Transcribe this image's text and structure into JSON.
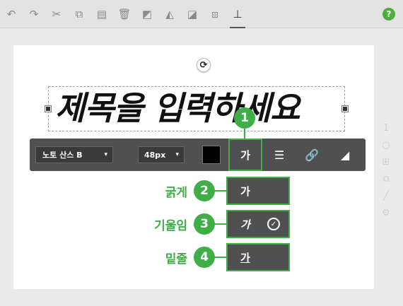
{
  "toolbar": {
    "buttons": [
      {
        "name": "undo-icon",
        "glyph": "↶"
      },
      {
        "name": "redo-icon",
        "glyph": "↷"
      },
      {
        "name": "cut-icon",
        "glyph": "✂"
      },
      {
        "name": "copy-icon",
        "glyph": "⧉"
      },
      {
        "name": "paste-icon",
        "glyph": "▤"
      },
      {
        "name": "delete-icon",
        "glyph": "🗑"
      },
      {
        "name": "layer-up-icon",
        "glyph": "◩"
      },
      {
        "name": "shape-icon",
        "glyph": "◭"
      },
      {
        "name": "layer-down-icon",
        "glyph": "◪"
      },
      {
        "name": "group-icon",
        "glyph": "⧈"
      },
      {
        "name": "align-icon",
        "glyph": "⊥"
      }
    ],
    "help_label": "?"
  },
  "canvas": {
    "rotate_glyph": "⟳",
    "title_text": "제목을 입력하세요"
  },
  "format_bar": {
    "font_family": "노토 산스 B",
    "font_size": "48px",
    "text_color": "#000000",
    "style_button_label": "가",
    "list_icon": "☰",
    "link_icon": "🔗",
    "gradient_icon": "◢"
  },
  "style_menu": {
    "items": [
      {
        "label": "가",
        "callout": "2",
        "description": "굵게"
      },
      {
        "label": "가",
        "callout": "3",
        "description": "기울임",
        "checked": true
      },
      {
        "label": "가",
        "callout": "4",
        "description": "밑줄"
      }
    ],
    "checked_glyph": "✓"
  },
  "callouts": {
    "main": "1"
  },
  "side_panel": {
    "page_number": "1",
    "icons": [
      "circle-icon",
      "add-page-icon",
      "duplicate-page-icon",
      "settings-icon"
    ]
  },
  "colors": {
    "accent": "#3fae46",
    "toolbar_bg": "#505050",
    "canvas_bg": "#ffffff",
    "app_bg": "#ebebeb"
  }
}
